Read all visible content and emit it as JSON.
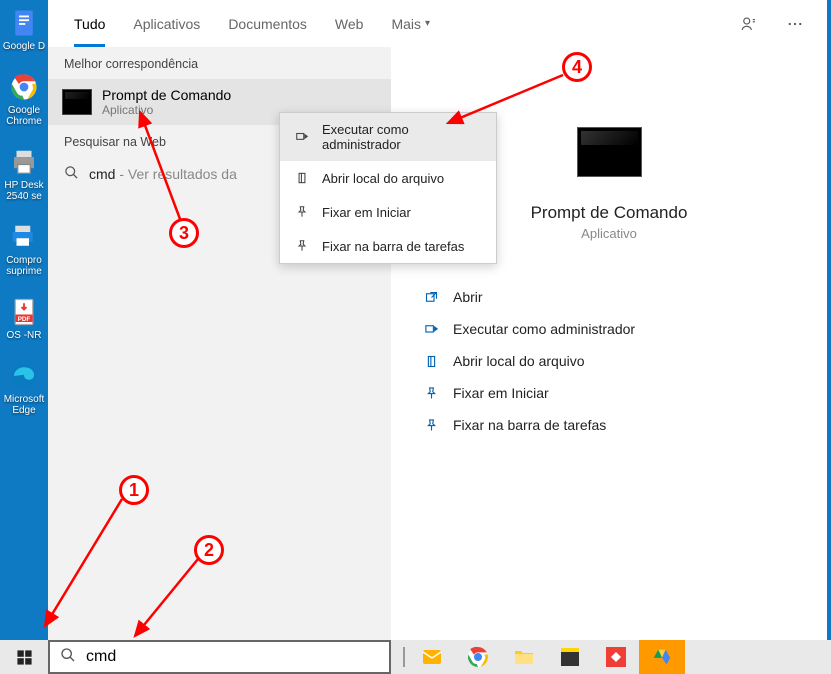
{
  "desktop": {
    "icons": [
      {
        "label": "Google D"
      },
      {
        "label": "Google Chrome"
      },
      {
        "label": "HP Desk 2540 se"
      },
      {
        "label": "Compro suprime"
      },
      {
        "label": "OS -NR"
      },
      {
        "label": "Microsoft Edge"
      }
    ]
  },
  "tabs": {
    "all": "Tudo",
    "apps": "Aplicativos",
    "docs": "Documentos",
    "web": "Web",
    "more": "Mais"
  },
  "section": {
    "best_match": "Melhor correspondência",
    "web_search": "Pesquisar na Web"
  },
  "result": {
    "title": "Prompt de Comando",
    "sub": "Aplicativo"
  },
  "web_item": {
    "prefix": "cmd",
    "suffix": " - Ver resultados da"
  },
  "context_menu": {
    "run_admin": "Executar como administrador",
    "open_location": "Abrir local do arquivo",
    "pin_start": "Fixar em Iniciar",
    "pin_taskbar": "Fixar na barra de tarefas"
  },
  "right_panel": {
    "name": "Prompt de Comando",
    "type": "Aplicativo",
    "actions": {
      "open": "Abrir",
      "run_admin": "Executar como administrador",
      "open_location": "Abrir local do arquivo",
      "pin_start": "Fixar em Iniciar",
      "pin_taskbar": "Fixar na barra de tarefas"
    }
  },
  "searchbox": {
    "value": "cmd"
  },
  "annotations": {
    "n1": "1",
    "n2": "2",
    "n3": "3",
    "n4": "4"
  }
}
